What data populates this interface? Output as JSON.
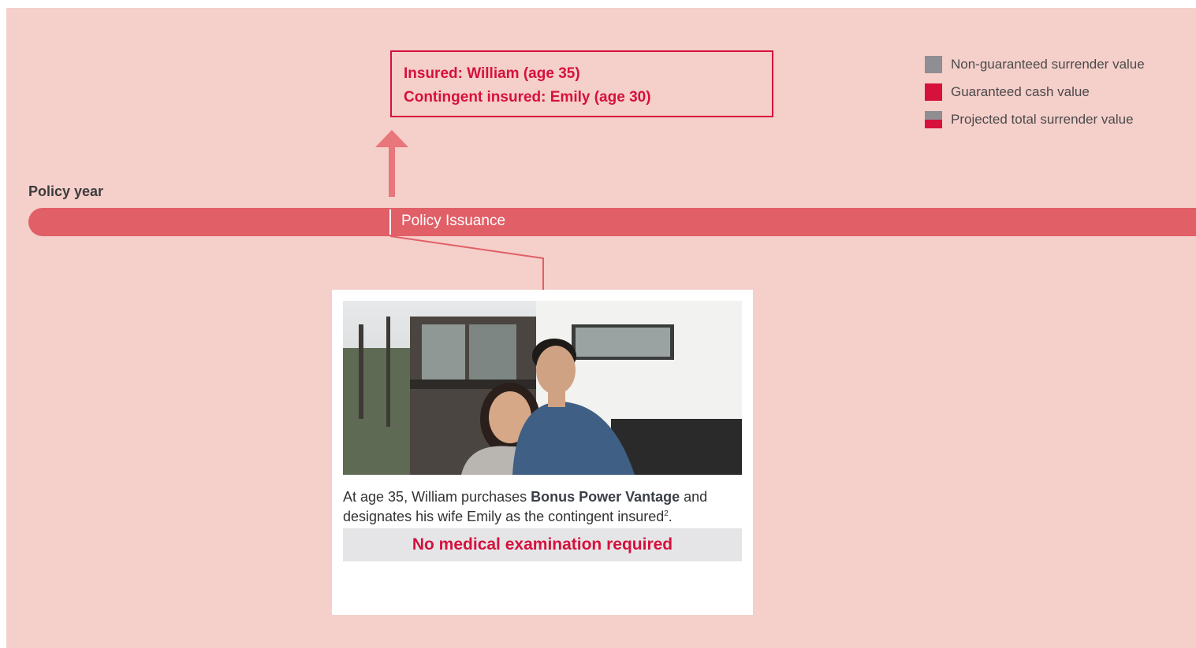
{
  "insured": {
    "line1": "Insured: William (age 35)",
    "line2": "Contingent insured: Emily (age 30)"
  },
  "legend": [
    {
      "label": "Non-guaranteed surrender value",
      "color": "#8e8e93"
    },
    {
      "label": "Guaranteed cash value",
      "color": "#d6113c"
    },
    {
      "label": "Projected total surrender value",
      "color": "#8e8e93/#d6113c"
    }
  ],
  "timeline": {
    "axis_label": "Policy year",
    "milestone_label": "Policy Issuance"
  },
  "card": {
    "text_before": "At age 35, William purchases ",
    "product_name": "Bonus Power Vantage",
    "text_after": " and designates his wife Emily as the contingent insured",
    "footnote": "2",
    "text_end": ".",
    "banner": "No medical examination required"
  },
  "colors": {
    "background": "#f5cfca",
    "accent": "#d6113c",
    "timeline": "#e15f67",
    "arrow": "#e8767a"
  }
}
